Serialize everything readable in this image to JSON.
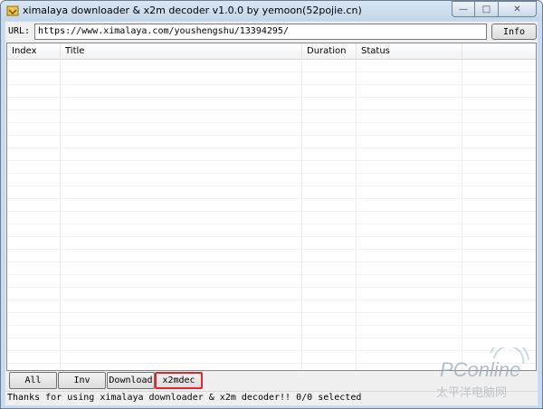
{
  "window": {
    "title": "ximalaya downloader & x2m decoder v1.0.0 by yemoon(52pojie.cn)",
    "caption_buttons": {
      "minimize": "—",
      "maximize": "□",
      "close": "✕"
    }
  },
  "url_bar": {
    "label": "URL:",
    "value": "https://www.ximalaya.com/youshengshu/13394295/",
    "info_button": "Info"
  },
  "list": {
    "columns": [
      "Index",
      "Title",
      "Duration",
      "Status"
    ],
    "rows": []
  },
  "buttons": {
    "all": "All",
    "inv": "Inv",
    "download": "Download",
    "x2mdec": "x2mdec"
  },
  "status_bar": {
    "message": "Thanks for using ximalaya downloader & x2m decoder!!",
    "selection": "0/0 selected"
  },
  "watermark": {
    "brand": "PConline",
    "subtitle": "太平洋电脑网"
  },
  "colors": {
    "titlebar": "#c9dcef",
    "highlight_border": "#e0262e",
    "client_bg": "#f0f0f0"
  }
}
